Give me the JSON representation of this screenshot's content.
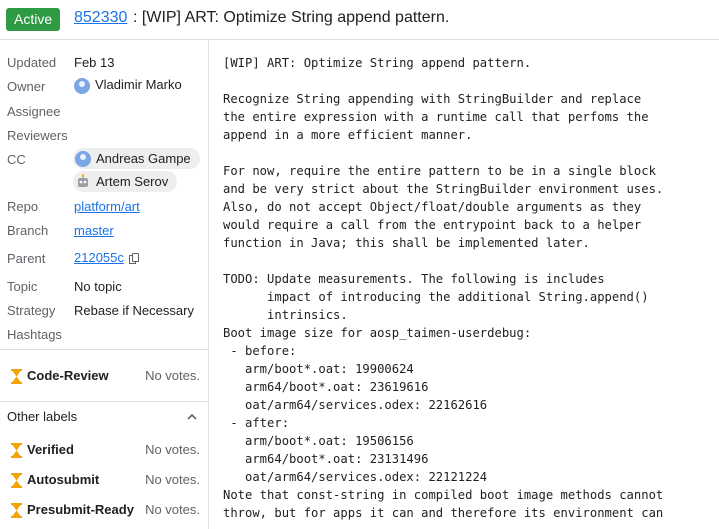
{
  "header": {
    "status": "Active",
    "change_number": "852330",
    "title": ": [WIP] ART: Optimize String append pattern.",
    "colors": {
      "status_bg": "#2e9a44",
      "link": "#1a73e8"
    }
  },
  "sidebar": {
    "updated": {
      "label": "Updated",
      "value": "Feb 13"
    },
    "owner": {
      "label": "Owner",
      "value": "Vladimir Marko",
      "icon": "account-icon"
    },
    "assignee": {
      "label": "Assignee"
    },
    "reviewers": {
      "label": "Reviewers"
    },
    "cc": {
      "label": "CC",
      "people": [
        {
          "name": "Andreas Gampe",
          "icon": "account-icon"
        },
        {
          "name": "Artem Serov",
          "icon": "robot-icon"
        }
      ]
    },
    "repo": {
      "label": "Repo",
      "value": "platform/art"
    },
    "branch": {
      "label": "Branch",
      "value": "master"
    },
    "parent": {
      "label": "Parent",
      "value": "212055c",
      "icon": "copy-icon"
    },
    "topic": {
      "label": "Topic",
      "value": "No topic"
    },
    "strategy": {
      "label": "Strategy",
      "value": "Rebase if Necessary"
    },
    "hashtags": {
      "label": "Hashtags"
    },
    "code_review": {
      "name": "Code-Review",
      "votes": "No votes.",
      "icon": "hourglass-icon"
    },
    "other_labels": {
      "title": "Other labels",
      "icon": "chevron-up-icon",
      "items": [
        {
          "name": "Verified",
          "votes": "No votes."
        },
        {
          "name": "Autosubmit",
          "votes": "No votes."
        },
        {
          "name": "Presubmit-Ready",
          "votes": "No votes."
        }
      ]
    }
  },
  "commit_message": "[WIP] ART: Optimize String append pattern.\n\nRecognize String appending with StringBuilder and replace\nthe entire expression with a runtime call that perfoms the\nappend in a more efficient manner.\n\nFor now, require the entire pattern to be in a single block\nand be very strict about the StringBuilder environment uses.\nAlso, do not accept Object/float/double arguments as they\nwould require a call from the entrypoint back to a helper\nfunction in Java; this shall be implemented later.\n\nTODO: Update measurements. The following is includes\n      impact of introducing the additional String.append()\n      intrinsics.\nBoot image size for aosp_taimen-userdebug:\n - before:\n   arm/boot*.oat: 19900624\n   arm64/boot*.oat: 23619616\n   oat/arm64/services.odex: 22162616\n - after:\n   arm/boot*.oat: 19506156\n   arm64/boot*.oat: 23131496\n   oat/arm64/services.odex: 22121224\nNote that const-string in compiled boot image methods cannot\nthrow, but for apps it can and therefore its environment can"
}
